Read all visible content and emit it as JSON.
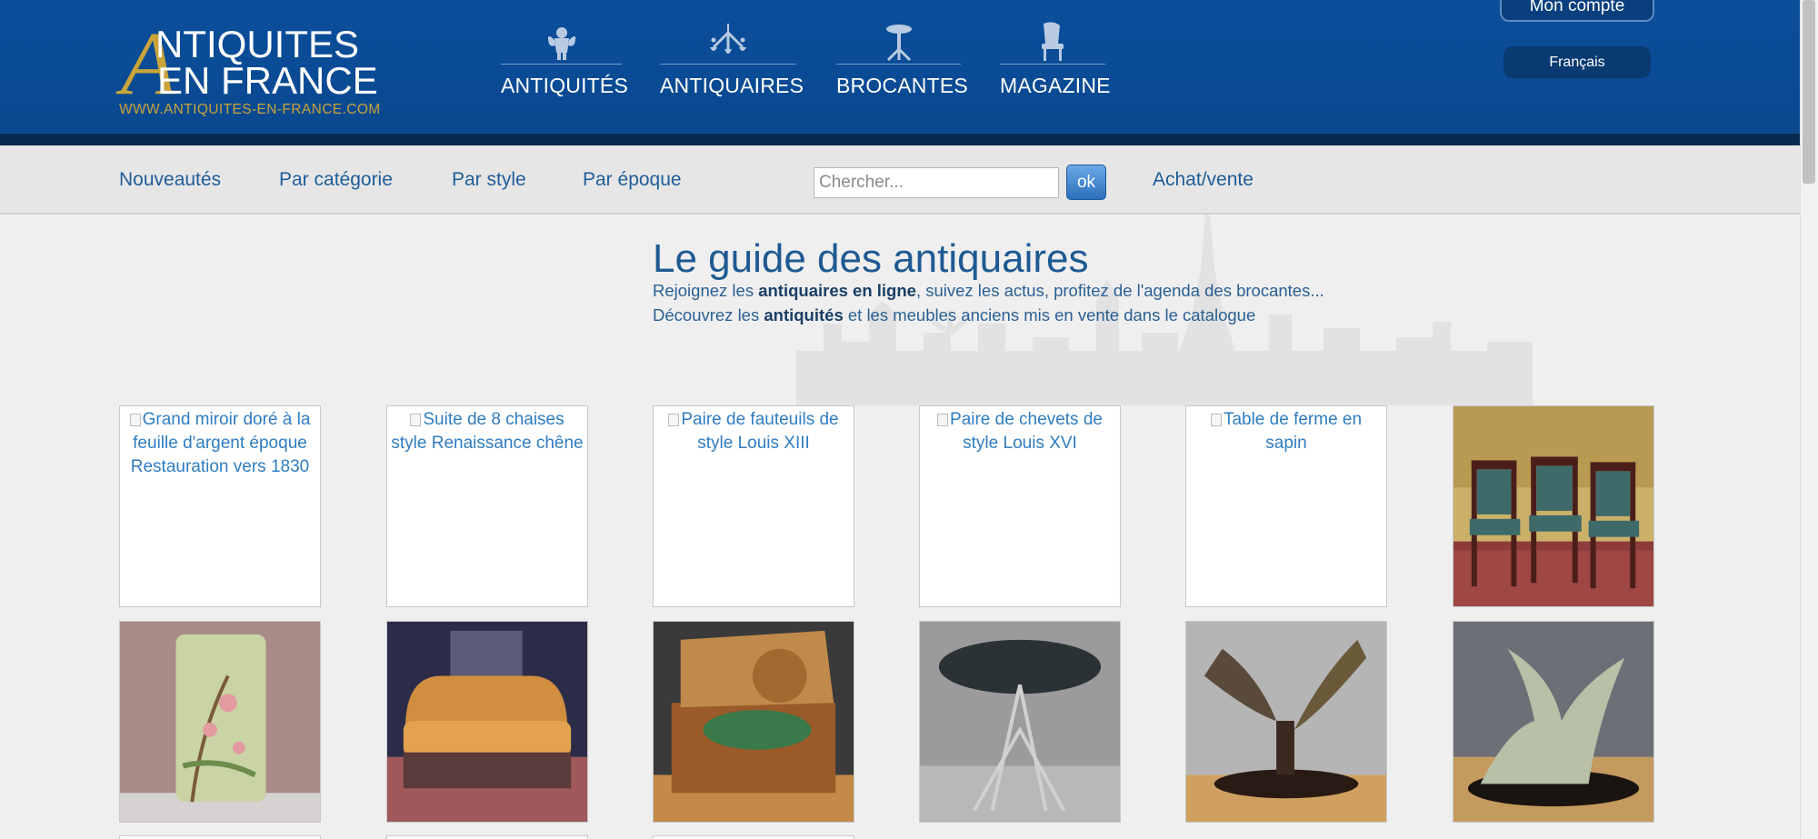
{
  "header": {
    "logo": {
      "letter": "A",
      "line1": "NTIQUITES",
      "line2": "EN FRANCE",
      "url": "WWW.ANTIQUITES-EN-FRANCE.COM"
    },
    "nav": [
      {
        "label": "ANTIQUITÉS",
        "icon": "cherub-icon"
      },
      {
        "label": "ANTIQUAIRES",
        "icon": "chandelier-icon"
      },
      {
        "label": "BROCANTES",
        "icon": "pedestal-table-icon"
      },
      {
        "label": "MAGAZINE",
        "icon": "chair-icon"
      }
    ],
    "account_label": "Mon compte",
    "language_label": "Français"
  },
  "subnav": {
    "links": [
      "Nouveautés",
      "Par catégorie",
      "Par style",
      "Par époque"
    ],
    "search_placeholder": "Chercher...",
    "search_button": "ok",
    "buy_sell": "Achat/vente"
  },
  "hero": {
    "title": "Le guide des antiquaires",
    "line1": {
      "a": "Rejoignez les ",
      "b": "antiquaires en ligne",
      "c": ", suivez les actus, profitez de l'agenda des brocantes..."
    },
    "line2": {
      "a": "Découvrez les ",
      "b": "antiquités",
      "c": " et les meubles anciens mis en vente dans le catalogue"
    }
  },
  "products": [
    {
      "alt": "Grand miroir doré à la feuille d'argent époque Restauration vers 1830",
      "image": null
    },
    {
      "alt": "Suite de 8 chaises style Renaissance chêne",
      "image": null
    },
    {
      "alt": "Paire de fauteuils de style Louis XIII",
      "image": null
    },
    {
      "alt": "Paire de chevets de style Louis XVI",
      "image": null
    },
    {
      "alt": "Table de ferme en sapin",
      "image": null
    },
    {
      "alt": "",
      "image": "dining-chairs"
    },
    {
      "alt": "",
      "image": "umbrella-vase"
    },
    {
      "alt": "",
      "image": "orange-loveseat"
    },
    {
      "alt": "",
      "image": "gramophone"
    },
    {
      "alt": "",
      "image": "glass-table"
    },
    {
      "alt": "",
      "image": "bronze-birds"
    },
    {
      "alt": "",
      "image": "green-birds"
    }
  ],
  "colors": {
    "header_blue": "#0b4e9a",
    "link_blue": "#1f5d9a",
    "gold": "#c8a43b"
  }
}
